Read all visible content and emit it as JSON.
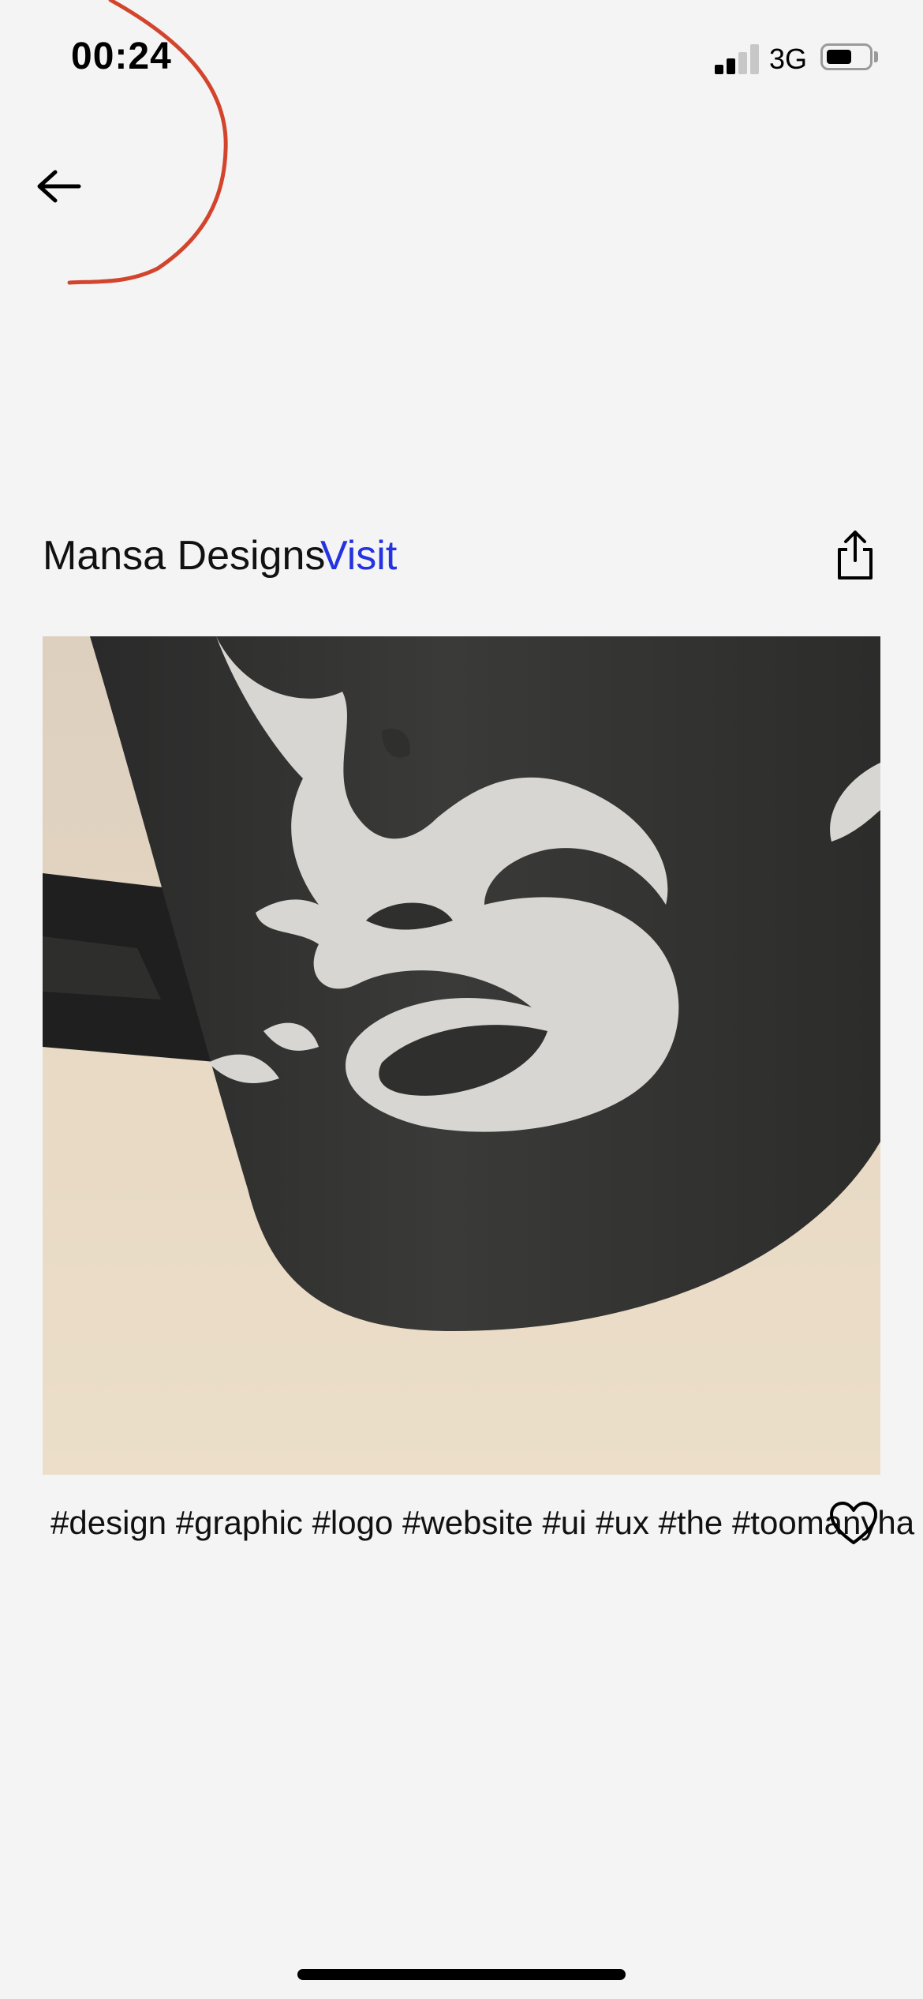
{
  "status_bar": {
    "time": "00:24",
    "network": "3G",
    "signal_bars_filled": 2,
    "signal_bars_total": 4,
    "battery_level": 0.6
  },
  "header": {
    "back_icon": "arrow-left-icon",
    "designer_name": "Mansa Designs",
    "visit_label": "Visit",
    "share_icon": "share-icon"
  },
  "post": {
    "image_subject": "black mug with white gecko print",
    "tags": "#design #graphic #logo #website #ui #ux #the #toomanyha",
    "like_icon": "heart-icon"
  },
  "colors": {
    "link": "#2432e0",
    "annotation_stroke": "#d2452c",
    "background": "#f4f4f4"
  }
}
